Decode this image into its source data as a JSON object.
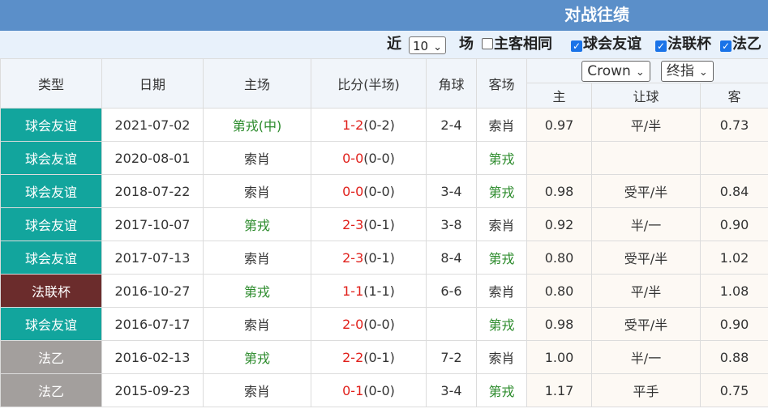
{
  "title": "对战往绩",
  "filter": {
    "near_label": "近",
    "count_value": "10",
    "count_unit": "场",
    "checkboxes": [
      {
        "label": "主客相同",
        "checked": false
      },
      {
        "label": "球会友谊",
        "checked": true
      },
      {
        "label": "法联杯",
        "checked": true
      },
      {
        "label": "法乙",
        "checked": true
      }
    ]
  },
  "headers": {
    "type": "类型",
    "date": "日期",
    "home": "主场",
    "score": "比分(半场)",
    "corner": "角球",
    "away": "客场",
    "company": "Crown",
    "odds_type": "终指",
    "odds_home": "主",
    "odds_handicap": "让球",
    "odds_away": "客"
  },
  "rows": [
    {
      "type": "球会友谊",
      "type_class": "t-club",
      "date": "2021-07-02",
      "home": "第戎(中)",
      "home_green": true,
      "score": "1-2",
      "half": "(0-2)",
      "corner": "2-4",
      "away": "索肖",
      "away_green": false,
      "odds_home": "0.97",
      "handicap": "平/半",
      "odds_away": "0.73"
    },
    {
      "type": "球会友谊",
      "type_class": "t-club",
      "date": "2020-08-01",
      "home": "索肖",
      "home_green": false,
      "score": "0-0",
      "half": "(0-0)",
      "corner": "",
      "away": "第戎",
      "away_green": true,
      "odds_home": "",
      "handicap": "",
      "odds_away": ""
    },
    {
      "type": "球会友谊",
      "type_class": "t-club",
      "date": "2018-07-22",
      "home": "索肖",
      "home_green": false,
      "score": "0-0",
      "half": "(0-0)",
      "corner": "3-4",
      "away": "第戎",
      "away_green": true,
      "odds_home": "0.98",
      "handicap": "受平/半",
      "odds_away": "0.84"
    },
    {
      "type": "球会友谊",
      "type_class": "t-club",
      "date": "2017-10-07",
      "home": "第戎",
      "home_green": true,
      "score": "2-3",
      "half": "(0-1)",
      "corner": "3-8",
      "away": "索肖",
      "away_green": false,
      "odds_home": "0.92",
      "handicap": "半/一",
      "odds_away": "0.90"
    },
    {
      "type": "球会友谊",
      "type_class": "t-club",
      "date": "2017-07-13",
      "home": "索肖",
      "home_green": false,
      "score": "2-3",
      "half": "(0-1)",
      "corner": "8-4",
      "away": "第戎",
      "away_green": true,
      "odds_home": "0.80",
      "handicap": "受平/半",
      "odds_away": "1.02"
    },
    {
      "type": "法联杯",
      "type_class": "t-cup",
      "date": "2016-10-27",
      "home": "第戎",
      "home_green": true,
      "score": "1-1",
      "half": "(1-1)",
      "corner": "6-6",
      "away": "索肖",
      "away_green": false,
      "odds_home": "0.80",
      "handicap": "平/半",
      "odds_away": "1.08"
    },
    {
      "type": "球会友谊",
      "type_class": "t-club",
      "date": "2016-07-17",
      "home": "索肖",
      "home_green": false,
      "score": "2-0",
      "half": "(0-0)",
      "corner": "",
      "away": "第戎",
      "away_green": true,
      "odds_home": "0.98",
      "handicap": "受平/半",
      "odds_away": "0.90"
    },
    {
      "type": "法乙",
      "type_class": "t-l2",
      "date": "2016-02-13",
      "home": "第戎",
      "home_green": true,
      "score": "2-2",
      "half": "(0-1)",
      "corner": "7-2",
      "away": "索肖",
      "away_green": false,
      "odds_home": "1.00",
      "handicap": "半/一",
      "odds_away": "0.88"
    },
    {
      "type": "法乙",
      "type_class": "t-l2",
      "date": "2015-09-23",
      "home": "索肖",
      "home_green": false,
      "score": "0-1",
      "half": "(0-0)",
      "corner": "3-4",
      "away": "第戎",
      "away_green": true,
      "odds_home": "1.17",
      "handicap": "平手",
      "odds_away": "0.75"
    }
  ]
}
